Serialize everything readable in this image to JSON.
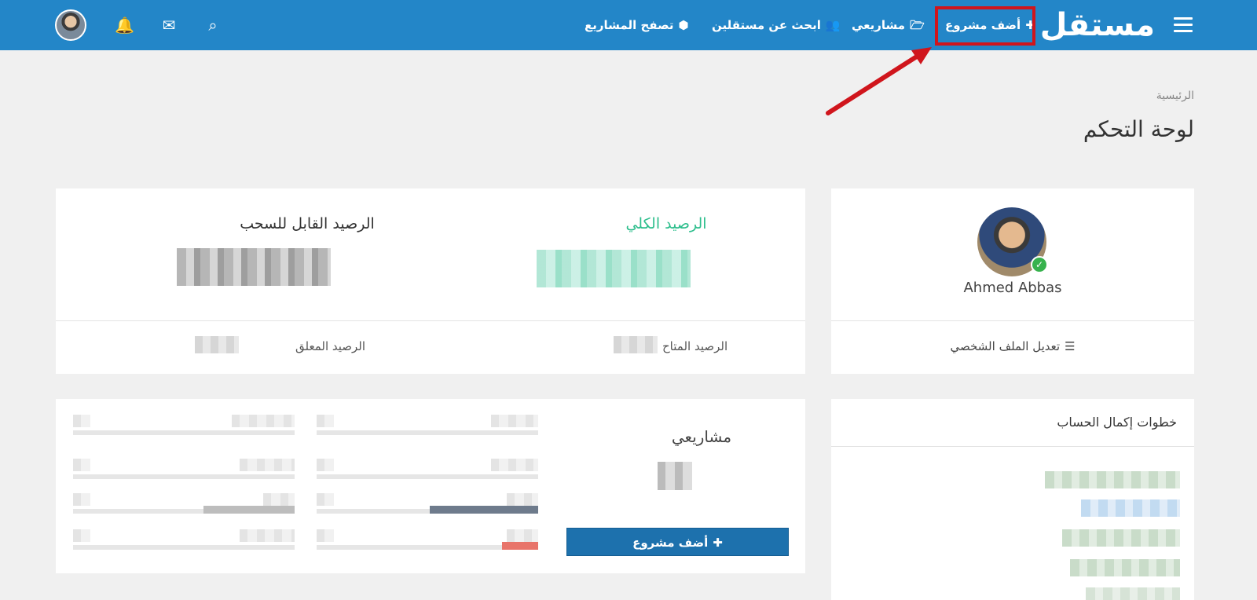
{
  "header": {
    "logo": "مستقل",
    "nav": [
      {
        "label": "أضف مشروع",
        "icon": "plus-icon"
      },
      {
        "label": "مشاريعي",
        "icon": "folder-open-icon"
      },
      {
        "label": "ابحث عن مستقلين",
        "icon": "users-icon"
      },
      {
        "label": "تصفح المشاريع",
        "icon": "cubes-icon"
      }
    ],
    "icons": [
      "search-icon",
      "envelope-icon",
      "bell-icon",
      "avatar"
    ]
  },
  "breadcrumb": "الرئيسية",
  "page_title": "لوحة التحكم",
  "profile": {
    "name": "Ahmed Abbas",
    "edit_label": "تعديل الملف الشخصي"
  },
  "balance": {
    "total_label": "الرصيد الكلي",
    "withdrawable_label": "الرصيد القابل للسحب",
    "available_label": "الرصيد المتاح",
    "pending_label": "الرصيد المعلق"
  },
  "steps": {
    "title": "خطوات إكمال الحساب"
  },
  "projects": {
    "title": "مشاريعي",
    "add_button": "أضف مشروع"
  },
  "colors": {
    "header_bg": "#2386c8",
    "accent_green": "#2dbe8c",
    "button_blue": "#1d71ad",
    "highlight_red": "#d0151c"
  }
}
